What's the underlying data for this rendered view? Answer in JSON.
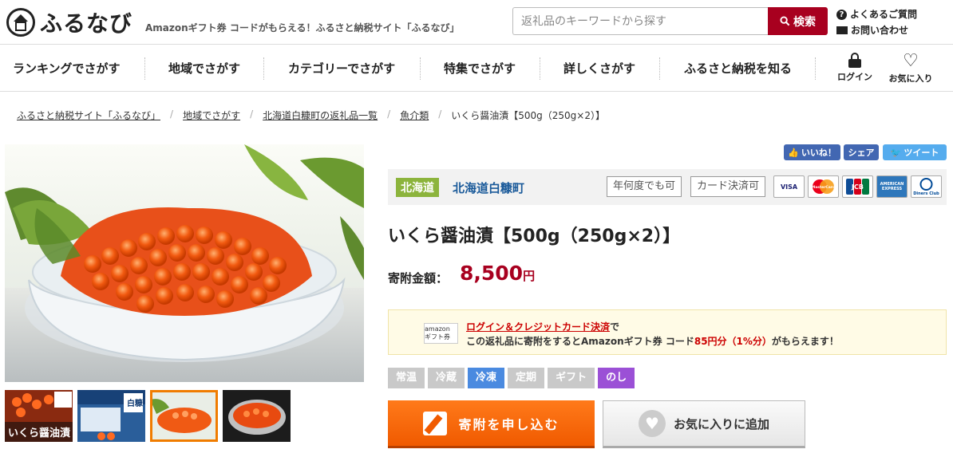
{
  "header": {
    "logo_text": "ふるなび",
    "tagline": "Amazonギフト券 コードがもらえる！ふるさと納税サイト「ふるなび」",
    "search_placeholder": "返礼品のキーワードから探す",
    "search_button": "検索",
    "faq_link": "よくあるご質問",
    "contact_link": "お問い合わせ"
  },
  "nav": {
    "items": [
      "ランキングでさがす",
      "地域でさがす",
      "カテゴリーでさがす",
      "特集でさがす",
      "詳しくさがす",
      "ふるさと納税を知る"
    ],
    "login": "ログイン",
    "favorites": "お気に入り"
  },
  "breadcrumb": [
    "ふるさと納税サイト「ふるなび」",
    "地域でさがす",
    "北海道白糠町の返礼品一覧",
    "魚介類",
    "いくら醤油漬【500g（250g×2）】"
  ],
  "share": {
    "like": "いいね！",
    "share": "シェア",
    "tweet": "ツイート"
  },
  "product": {
    "prefecture": "北海道",
    "municipality": "北海道白糠町",
    "tags": [
      "年何度でも可",
      "カード決済可"
    ],
    "cards": [
      "VISA",
      "MasterCard",
      "JCB",
      "AMERICAN EXPRESS",
      "Diners Club"
    ],
    "title": "いくら醤油漬【500g（250g×2）】",
    "price_label": "寄附金額：",
    "price": "8,500",
    "price_unit": "円"
  },
  "thumbnail_captions": {
    "thumb1": "いくら醤油漬",
    "thumb2": "白糠"
  },
  "amazon": {
    "logo": "amazon ギフト券",
    "link_text": "ログイン＆クレジットカード決済",
    "after_link": "で",
    "line2_prefix": "この返礼品に寄附をするとAmazonギフト券 コード",
    "line2_amount": "85円分（1%分）",
    "line2_suffix": "がもらえます！"
  },
  "temperature": {
    "labels": [
      "常温",
      "冷蔵",
      "冷凍",
      "定期",
      "ギフト",
      "のし"
    ],
    "active": "冷凍"
  },
  "buttons": {
    "apply": "寄附を申し込む",
    "favorite": "お気に入りに追加"
  },
  "colors": {
    "brand_red": "#a8001f",
    "apply_orange": "#f05a00",
    "region_green": "#8cb43c",
    "frozen_blue": "#4a8ae0",
    "noshi_purple": "#9b50d6"
  }
}
